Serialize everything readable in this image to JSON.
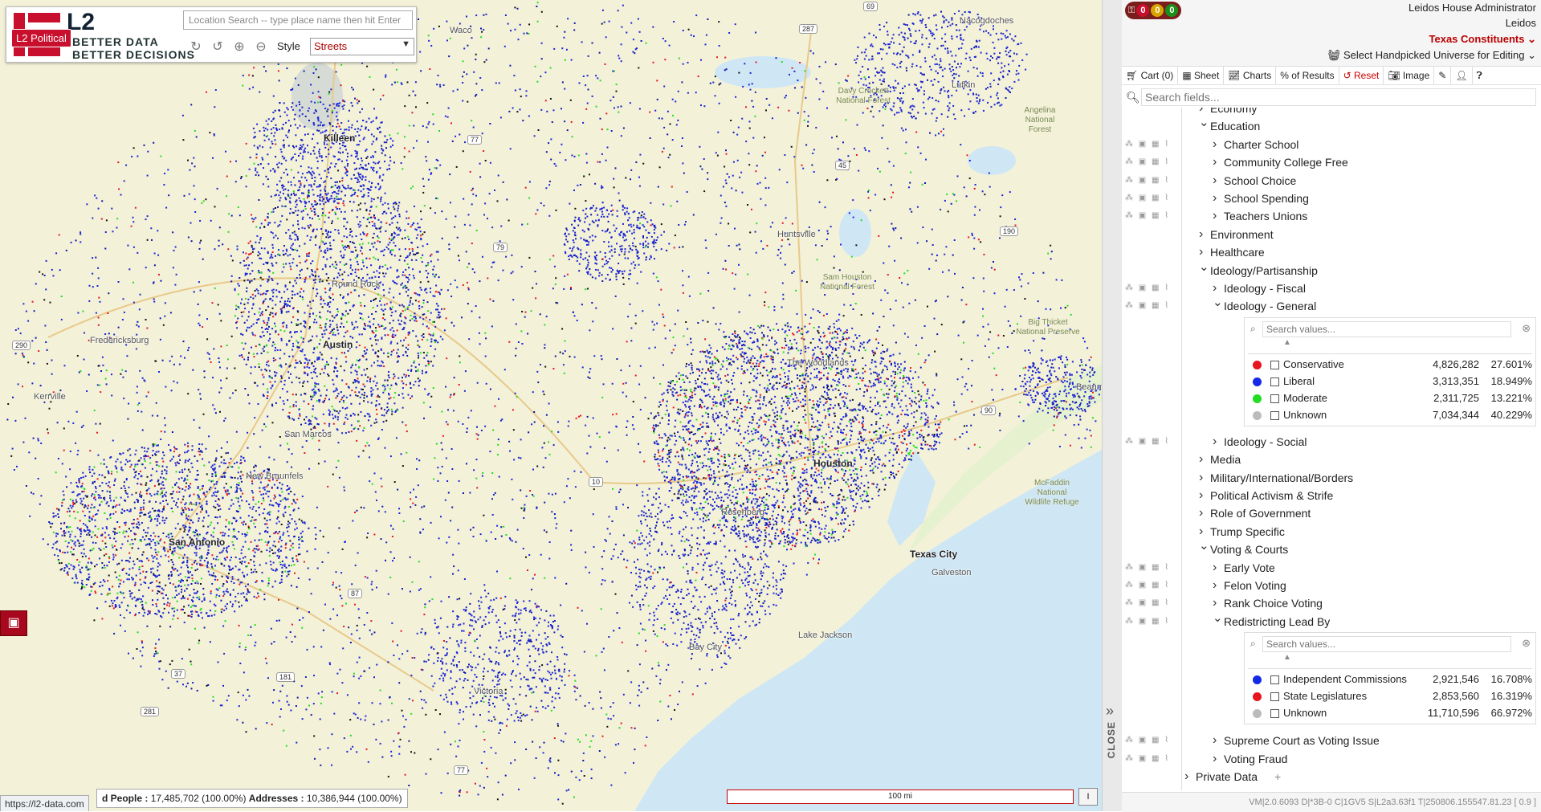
{
  "map": {
    "search_placeholder": "Location Search -- type place name then hit Enter",
    "style_label": "Style",
    "style_value": "Streets",
    "brand_badge": "L2 Political",
    "logo_text": "L2",
    "logo_tag1": "BETTER DATA",
    "logo_tag2": "BETTER DECISIONS",
    "cities": [
      {
        "name": "Killeen",
        "cls": "city"
      },
      {
        "name": "Austin",
        "cls": "city"
      },
      {
        "name": "San Marcos",
        "cls": "city minor"
      },
      {
        "name": "New Braunfels",
        "cls": "city minor"
      },
      {
        "name": "San Antonio",
        "cls": "city"
      },
      {
        "name": "Houston",
        "cls": "city"
      },
      {
        "name": "Texas City",
        "cls": "city"
      },
      {
        "name": "Galveston",
        "cls": "city minor"
      },
      {
        "name": "Bay City",
        "cls": "city minor"
      },
      {
        "name": "Lake Jackson",
        "cls": "city minor"
      },
      {
        "name": "Victoria",
        "cls": "city minor"
      },
      {
        "name": "Huntsville",
        "cls": "city minor"
      },
      {
        "name": "The Woodlands",
        "cls": "city minor"
      },
      {
        "name": "Round Rock",
        "cls": "city minor"
      },
      {
        "name": "Fredericksburg",
        "cls": "city minor"
      },
      {
        "name": "Kerrville",
        "cls": "city minor"
      },
      {
        "name": "Nacogdoches",
        "cls": "city minor"
      },
      {
        "name": "Lufkin",
        "cls": "city minor"
      },
      {
        "name": "Waco",
        "cls": "city minor"
      },
      {
        "name": "Rosenberg",
        "cls": "city minor"
      },
      {
        "name": "Beaumont",
        "cls": "city minor"
      }
    ],
    "parks": [
      "Davy Crockett National Forest",
      "Angelina National Forest",
      "Sam Houston National Forest",
      "Big Thicket National Preserve",
      "McFaddin National Wildlife Refuge"
    ],
    "shields": [
      "287",
      "79",
      "77",
      "190",
      "45",
      "10",
      "90",
      "87",
      "181",
      "77",
      "37",
      "281",
      "69",
      "290"
    ],
    "status_people_label": "d People :",
    "status_people_value": "17,485,702 (100.00%)",
    "status_addr_label": "Addresses :",
    "status_addr_value": "10,386,944 (100.00%)",
    "url": "https://l2-data.com",
    "scale": "100 mi",
    "scale_btn": "I"
  },
  "panel": {
    "counters": [
      "0",
      "0",
      "0"
    ],
    "user": "Leidos House Administrator",
    "org": "Leidos",
    "universe": "Texas Constituents",
    "handpicked": "Select Handpicked Universe for Editing",
    "toolbar": {
      "cart": "Cart (0)",
      "sheet": "Sheet",
      "charts": "Charts",
      "pct": "% of Results",
      "reset": "Reset",
      "image": "Image"
    },
    "search_placeholder": "Search fields...",
    "close_label": "CLOSE",
    "version": "VM|2.0.6093 D|*3B-0 C|1GV5 S|L2a3.63f1 T|250806.155547.81.23 [ 0.9 ]",
    "tree": [
      {
        "label": "Economy",
        "level": 1,
        "open": false,
        "icons": false
      },
      {
        "label": "Education",
        "level": 1,
        "open": true,
        "icons": false
      },
      {
        "label": "Charter School",
        "level": 2,
        "open": false,
        "icons": true
      },
      {
        "label": "Community College Free",
        "level": 2,
        "open": false,
        "icons": true
      },
      {
        "label": "School Choice",
        "level": 2,
        "open": false,
        "icons": true
      },
      {
        "label": "School Spending",
        "level": 2,
        "open": false,
        "icons": true
      },
      {
        "label": "Teachers Unions",
        "level": 2,
        "open": false,
        "icons": true
      },
      {
        "label": "Environment",
        "level": 1,
        "open": false,
        "icons": false
      },
      {
        "label": "Healthcare",
        "level": 1,
        "open": false,
        "icons": false
      },
      {
        "label": "Ideology/Partisanship",
        "level": 1,
        "open": true,
        "icons": false
      },
      {
        "label": "Ideology - Fiscal",
        "level": 2,
        "open": false,
        "icons": true
      },
      {
        "label": "Ideology - General",
        "level": 2,
        "open": true,
        "icons": true
      },
      {
        "label": "Ideology - Social",
        "level": 2,
        "open": false,
        "icons": true
      },
      {
        "label": "Media",
        "level": 1,
        "open": false,
        "icons": false
      },
      {
        "label": "Military/International/Borders",
        "level": 1,
        "open": false,
        "icons": false
      },
      {
        "label": "Political Activism & Strife",
        "level": 1,
        "open": false,
        "icons": false
      },
      {
        "label": "Role of Government",
        "level": 1,
        "open": false,
        "icons": false
      },
      {
        "label": "Trump Specific",
        "level": 1,
        "open": false,
        "icons": false
      },
      {
        "label": "Voting & Courts",
        "level": 1,
        "open": true,
        "icons": false
      },
      {
        "label": "Early Vote",
        "level": 2,
        "open": false,
        "icons": true
      },
      {
        "label": "Felon Voting",
        "level": 2,
        "open": false,
        "icons": true
      },
      {
        "label": "Rank Choice Voting",
        "level": 2,
        "open": false,
        "icons": true
      },
      {
        "label": "Redistricting Lead By",
        "level": 2,
        "open": true,
        "icons": true
      },
      {
        "label": "Supreme Court as Voting Issue",
        "level": 2,
        "open": false,
        "icons": true
      },
      {
        "label": "Voting Fraud",
        "level": 2,
        "open": false,
        "icons": true
      },
      {
        "label": "Private Data",
        "level": 0,
        "open": false,
        "icons": false
      }
    ],
    "ideology_values": {
      "search_placeholder": "Search values...",
      "rows": [
        {
          "name": "Conservative",
          "count": "4,826,282",
          "pct": "27.601%",
          "color": "#e8141e"
        },
        {
          "name": "Liberal",
          "count": "3,313,351",
          "pct": "18.949%",
          "color": "#1428e8"
        },
        {
          "name": "Moderate",
          "count": "2,311,725",
          "pct": "13.221%",
          "color": "#22dd22"
        },
        {
          "name": "Unknown",
          "count": "7,034,344",
          "pct": "40.229%",
          "color": "#bbbbbb"
        }
      ]
    },
    "redistricting_values": {
      "search_placeholder": "Search values...",
      "rows": [
        {
          "name": "Independent Commissions",
          "count": "2,921,546",
          "pct": "16.708%",
          "color": "#1428e8"
        },
        {
          "name": "State Legislatures",
          "count": "2,853,560",
          "pct": "16.319%",
          "color": "#e8141e"
        },
        {
          "name": "Unknown",
          "count": "11,710,596",
          "pct": "66.972%",
          "color": "#bbbbbb"
        }
      ]
    }
  }
}
